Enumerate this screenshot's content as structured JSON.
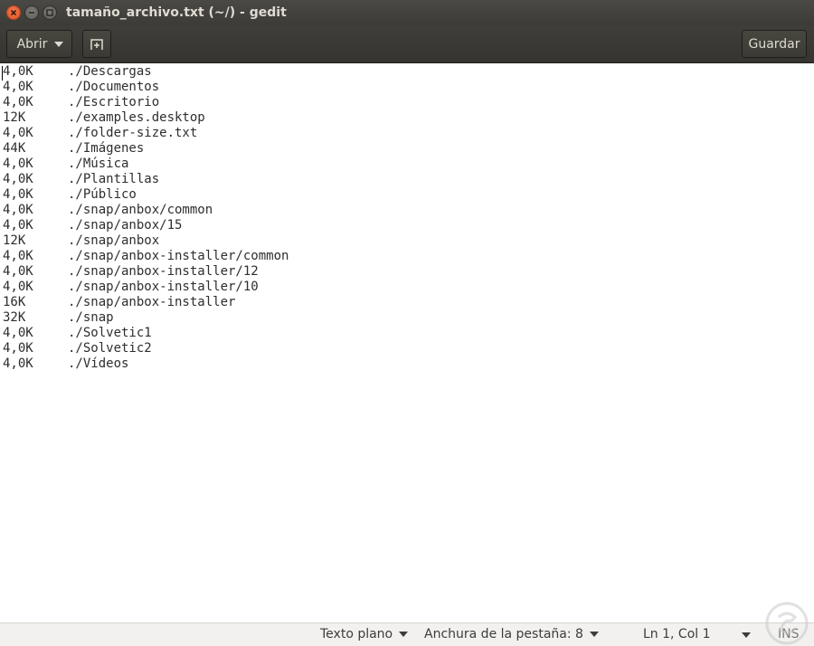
{
  "window": {
    "title": "tamaño_archivo.txt (~/) - gedit"
  },
  "header": {
    "open_label": "Abrir",
    "save_label": "Guardar",
    "new_tab_icon": "new-tab-icon"
  },
  "editor": {
    "lines": [
      {
        "size": "4,0K",
        "path": "./Descargas"
      },
      {
        "size": "4,0K",
        "path": "./Documentos"
      },
      {
        "size": "4,0K",
        "path": "./Escritorio"
      },
      {
        "size": "12K",
        "path": "./examples.desktop"
      },
      {
        "size": "4,0K",
        "path": "./folder-size.txt"
      },
      {
        "size": "44K",
        "path": "./Imágenes"
      },
      {
        "size": "4,0K",
        "path": "./Música"
      },
      {
        "size": "4,0K",
        "path": "./Plantillas"
      },
      {
        "size": "4,0K",
        "path": "./Público"
      },
      {
        "size": "4,0K",
        "path": "./snap/anbox/common"
      },
      {
        "size": "4,0K",
        "path": "./snap/anbox/15"
      },
      {
        "size": "12K",
        "path": "./snap/anbox"
      },
      {
        "size": "4,0K",
        "path": "./snap/anbox-installer/common"
      },
      {
        "size": "4,0K",
        "path": "./snap/anbox-installer/12"
      },
      {
        "size": "4,0K",
        "path": "./snap/anbox-installer/10"
      },
      {
        "size": "16K",
        "path": "./snap/anbox-installer"
      },
      {
        "size": "32K",
        "path": "./snap"
      },
      {
        "size": "4,0K",
        "path": "./Solvetic1"
      },
      {
        "size": "4,0K",
        "path": "./Solvetic2"
      },
      {
        "size": "4,0K",
        "path": "./Vídeos"
      }
    ]
  },
  "status": {
    "language": "Texto plano",
    "tab_width": "Anchura de la pestaña: 8",
    "position": "Ln 1, Col 1",
    "mode": "INS"
  },
  "colors": {
    "titlebar": "#3c3b37",
    "close_button": "#e0521f",
    "text": "#2e2e2e",
    "statusbar": "#f2f1f0"
  }
}
